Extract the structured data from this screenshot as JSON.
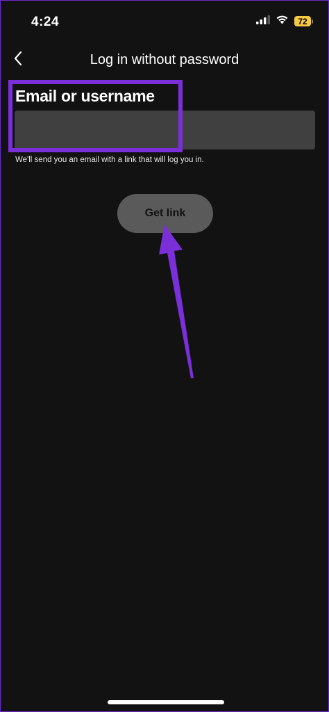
{
  "status_bar": {
    "time": "4:24",
    "battery_level": "72",
    "icons": [
      "cellular-signal-icon",
      "wifi-icon",
      "battery-icon"
    ]
  },
  "header": {
    "back_icon": "chevron-left-icon",
    "title": "Log in without password"
  },
  "form": {
    "label": "Email or username",
    "value": "",
    "helper": "We'll send you an email with a link that will log you in."
  },
  "button": {
    "label": "Get link"
  },
  "annotation": {
    "color": "#7b2fd9",
    "arrow_icon": "arrow-up-icon"
  },
  "colors": {
    "background": "#121212",
    "input": "#404040",
    "button": "#5a5a5a",
    "battery": "#f7c844"
  }
}
